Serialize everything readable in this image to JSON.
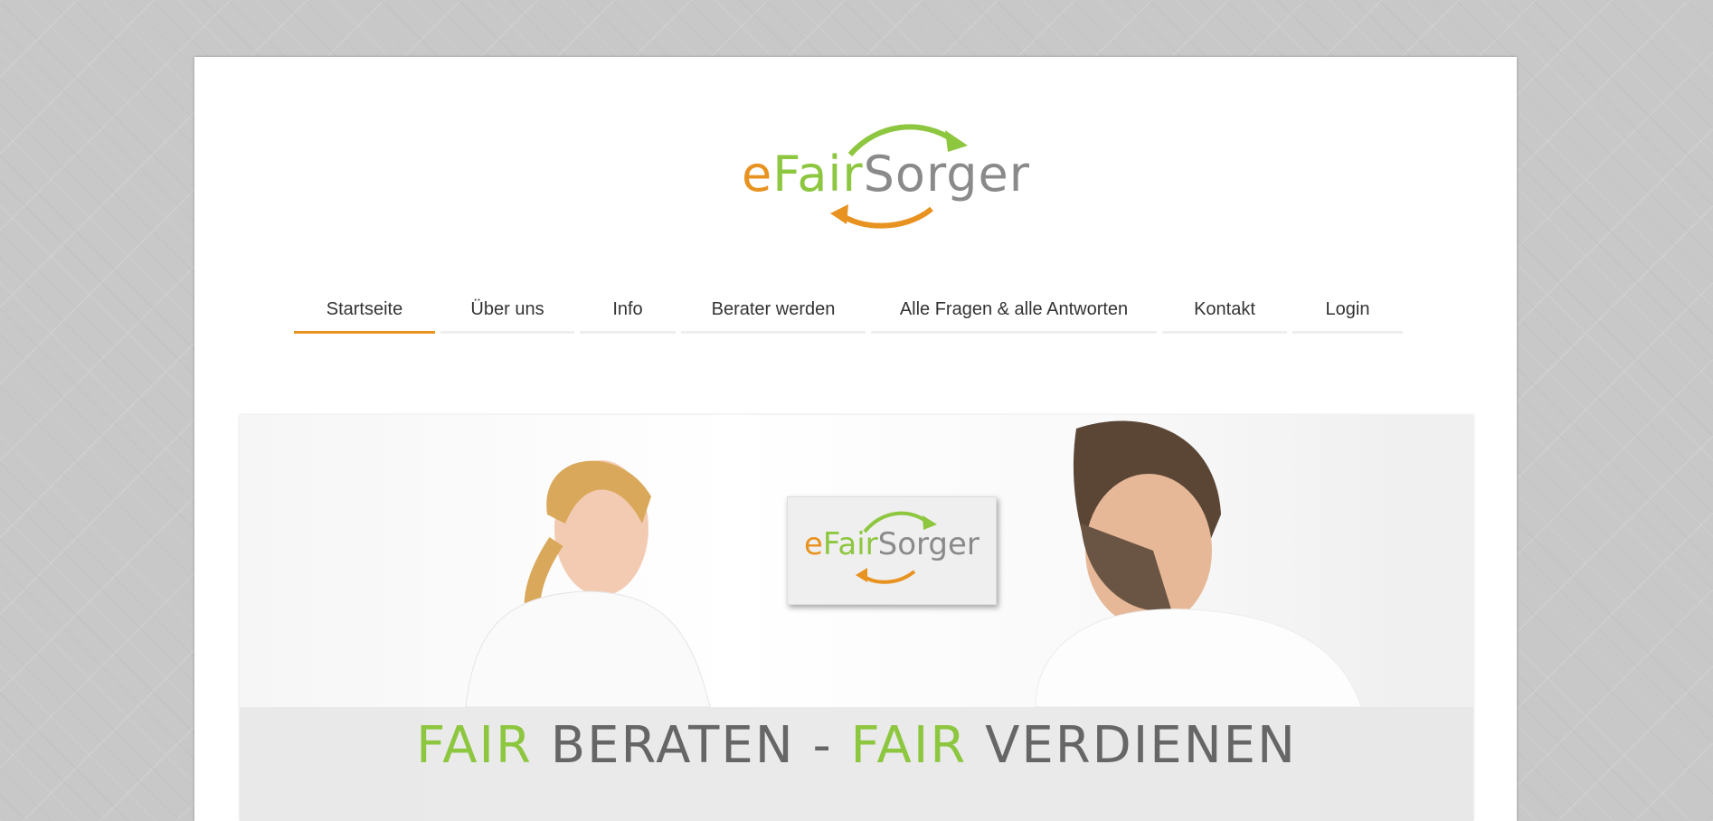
{
  "logo": {
    "part_e": "e",
    "part_fair": "Fair",
    "part_sorger": "Sorger"
  },
  "nav": {
    "items": [
      {
        "label": "Startseite"
      },
      {
        "label": "Über uns"
      },
      {
        "label": "Info"
      },
      {
        "label": "Berater werden"
      },
      {
        "label": "Alle Fragen & alle Antworten"
      },
      {
        "label": "Kontakt"
      },
      {
        "label": "Login"
      }
    ],
    "active_index": 0
  },
  "hero": {
    "caption_fair_1": "FAIR",
    "caption_mid": " BERATEN - ",
    "caption_fair_2": "FAIR",
    "caption_end": " VERDIENEN",
    "card_e": "e",
    "card_fair": "Fair",
    "card_sorger": "Sorger"
  },
  "colors": {
    "orange": "#e8921f",
    "green": "#8dc63f",
    "gray": "#8a8a8a"
  }
}
